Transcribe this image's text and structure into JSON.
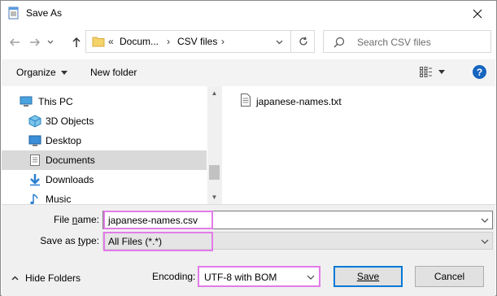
{
  "window": {
    "title": "Save As"
  },
  "address": {
    "overflow": "«",
    "segments": [
      "Docum...",
      "CSV files"
    ]
  },
  "search": {
    "placeholder": "Search CSV files"
  },
  "toolbar": {
    "organize": "Organize",
    "new_folder": "New folder",
    "help": "?"
  },
  "nav": {
    "items": [
      {
        "label": "This PC",
        "icon": "pc-icon"
      },
      {
        "label": "3D Objects",
        "icon": "3d-objects-icon"
      },
      {
        "label": "Desktop",
        "icon": "desktop-icon"
      },
      {
        "label": "Documents",
        "icon": "documents-icon",
        "selected": true
      },
      {
        "label": "Downloads",
        "icon": "downloads-icon"
      },
      {
        "label": "Music",
        "icon": "music-icon"
      }
    ]
  },
  "files": [
    {
      "name": "japanese-names.txt",
      "icon": "text-file-icon"
    }
  ],
  "form": {
    "file_name_label": "File name:",
    "file_name_value": "japanese-names.csv",
    "save_type_label": "Save as type:",
    "save_type_value": "All Files  (*.*)",
    "hide_folders": "Hide Folders",
    "encoding_label": "Encoding:",
    "encoding_value": "UTF-8 with BOM",
    "save": "Save",
    "cancel": "Cancel"
  },
  "colors": {
    "highlight": "#e27be9",
    "accent": "#0078d7",
    "help": "#1565c0"
  }
}
